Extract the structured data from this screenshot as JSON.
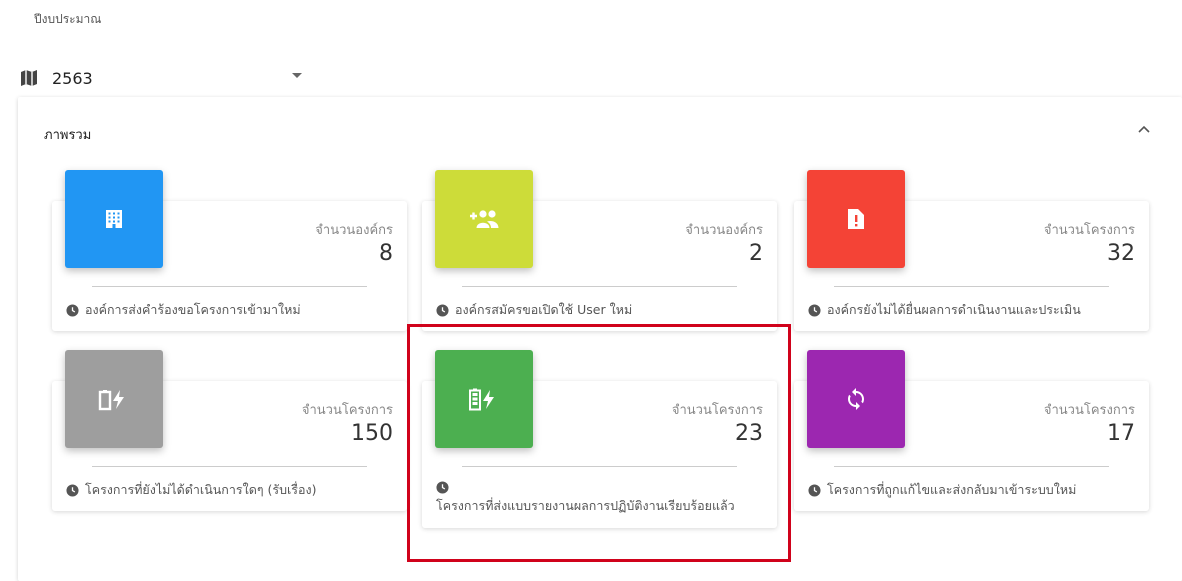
{
  "header": {
    "year_label": "ปีงบประมาณ",
    "year_value": "2563"
  },
  "panel": {
    "title": "ภาพรวม"
  },
  "cards": [
    {
      "title": "จำนวนองค์กร",
      "value": "8",
      "footer": "องค์การส่งคำร้องขอโครงการเข้ามาใหม่",
      "color": "#2196f3",
      "icon": "building-icon"
    },
    {
      "title": "จำนวนองค์กร",
      "value": "2",
      "footer": "องค์กรสมัครขอเปิดใช้ User ใหม่",
      "color": "#cddc39",
      "icon": "add-users-icon"
    },
    {
      "title": "จำนวนโครงการ",
      "value": "32",
      "footer": "องค์กรยังไม่ได้ยื่นผลการดำเนินงานและประเมิน",
      "color": "#f44336",
      "icon": "alert-document-icon"
    },
    {
      "title": "จำนวนโครงการ",
      "value": "150",
      "footer": "โครงการที่ยังไม่ได้ดำเนินการใดๆ (รับเรื่อง)",
      "color": "#9e9e9e",
      "icon": "battery-empty-charging-icon"
    },
    {
      "title": "จำนวนโครงการ",
      "value": "23",
      "footer": "โครงการที่ส่งแบบรายงานผลการปฏิบัติงานเรียบร้อยแล้ว",
      "color": "#4caf50",
      "icon": "battery-full-charging-icon"
    },
    {
      "title": "จำนวนโครงการ",
      "value": "17",
      "footer": "โครงการที่ถูกแก้ไขและส่งกลับมาเข้าระบบใหม่",
      "color": "#9c27b0",
      "icon": "sync-icon"
    }
  ]
}
